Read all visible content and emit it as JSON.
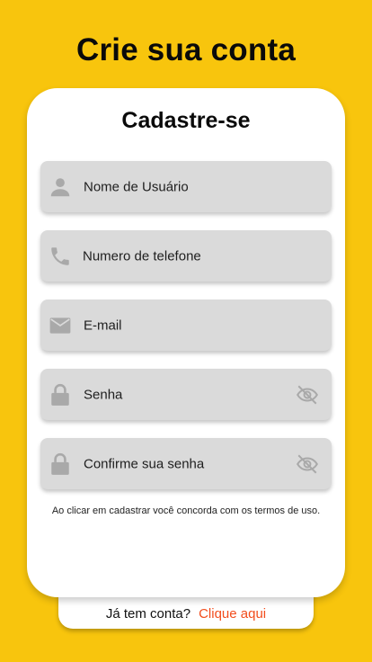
{
  "page": {
    "title": "Crie sua conta"
  },
  "card": {
    "title": "Cadastre-se",
    "fields": [
      {
        "placeholder": "Nome de Usuário",
        "icon": "person-icon"
      },
      {
        "placeholder": "Numero de telefone",
        "icon": "phone-icon"
      },
      {
        "placeholder": "E-mail",
        "icon": "mail-icon"
      },
      {
        "placeholder": "Senha",
        "icon": "lock-icon",
        "toggle_icon": "eye-off-icon"
      },
      {
        "placeholder": "Confirme sua senha",
        "icon": "lock-icon",
        "toggle_icon": "eye-off-icon"
      }
    ],
    "terms": "Ao clicar em cadastrar você concorda com os termos de uso."
  },
  "login": {
    "question": "Já tem conta?",
    "link": "Clique aqui"
  },
  "colors": {
    "background": "#F8C50D",
    "field": "#DADADA",
    "link": "#F24D1D",
    "icon": "#A9A9A9"
  }
}
